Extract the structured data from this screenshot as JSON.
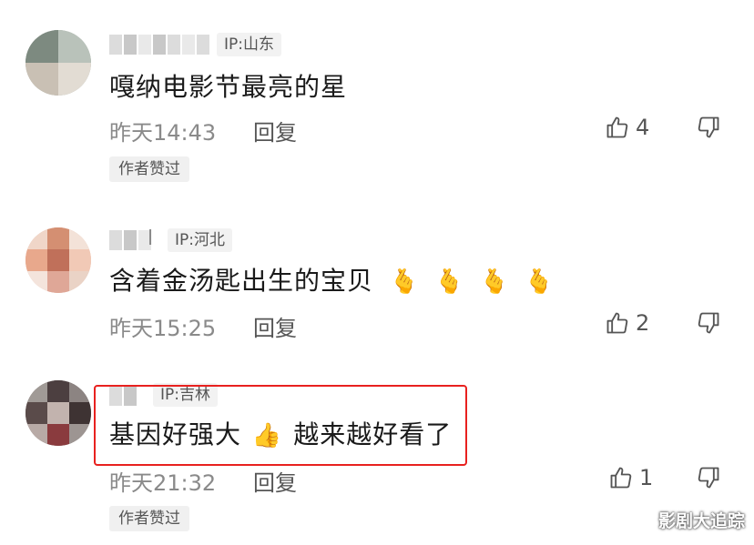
{
  "comments": [
    {
      "ip": "IP:山东",
      "text": "嘎纳电影节最亮的星",
      "time": "昨天14:43",
      "reply": "回复",
      "likes": "4",
      "author_liked": "作者赞过"
    },
    {
      "ip": "IP:河北",
      "name_suffix": "l",
      "text": "含着金汤匙出生的宝贝",
      "emojis": [
        "🫰",
        "🫰",
        "🫰",
        "🫰"
      ],
      "time": "昨天15:25",
      "reply": "回复",
      "likes": "2"
    },
    {
      "ip": "IP:吉林",
      "text_part1": "基因好强大",
      "emoji": "👍",
      "text_part2": "越来越好看了",
      "time": "昨天21:32",
      "reply": "回复",
      "likes": "1",
      "author_liked": "作者赞过"
    }
  ],
  "icons": {
    "like": "thumbs-up-outline-icon",
    "dislike": "thumbs-down-outline-icon"
  },
  "colors": {
    "highlight": "#e8211f",
    "tag_bg": "#f2f2f2"
  },
  "watermark": "影剧大追踪"
}
